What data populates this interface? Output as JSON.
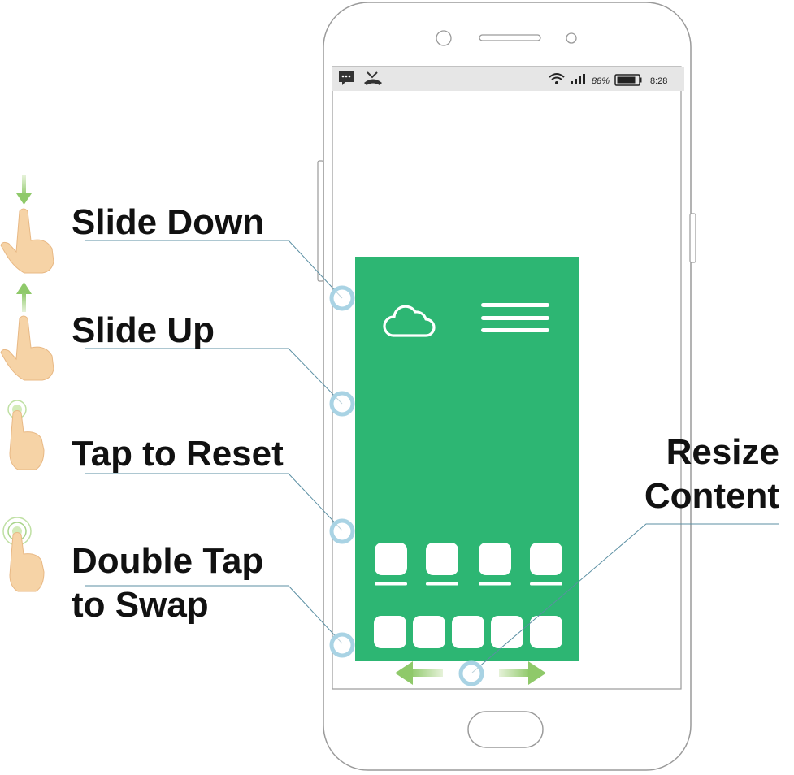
{
  "gestures": [
    {
      "id": "slide-down",
      "label": "Slide Down",
      "hand_icon": "hand-slide-down-icon"
    },
    {
      "id": "slide-up",
      "label": "Slide Up",
      "hand_icon": "hand-slide-up-icon"
    },
    {
      "id": "tap-reset",
      "label": "Tap to Reset",
      "hand_icon": "hand-tap-icon"
    },
    {
      "id": "double-tap",
      "label_line1": "Double Tap",
      "label_line2": "to Swap",
      "hand_icon": "hand-double-tap-icon"
    }
  ],
  "resize": {
    "line1": "Resize",
    "line2": "Content"
  },
  "status_bar": {
    "battery": "88%",
    "time": "8:28",
    "icons": [
      "message-icon",
      "missed-call-icon",
      "wifi-icon",
      "signal-icon",
      "battery-icon"
    ]
  },
  "app_screen": {
    "background": "#2db673",
    "icons": [
      "cloud-icon",
      "menu-icon"
    ],
    "app_row_count": 4,
    "dock_count": 5
  },
  "colors": {
    "touch_point": "#a9d3e4",
    "arrow": "#8fc96a",
    "skin": "#f6d3a6",
    "leader_line": "#5b8fa3"
  }
}
